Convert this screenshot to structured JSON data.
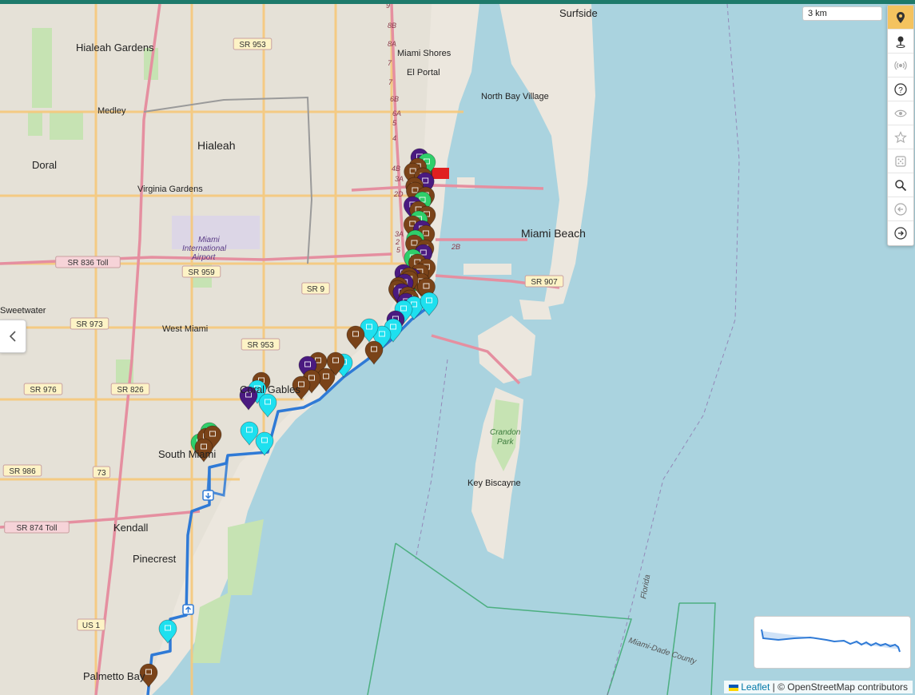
{
  "colors": {
    "topbar": "#1e7a6b",
    "water": "#aad3df",
    "land": "#f2efe9",
    "urban": "#e6e1d8",
    "green": "#c8e6b4",
    "route": "#2f7ad6",
    "marker_brown": "#7a4319",
    "marker_cyan": "#1ee0ef",
    "marker_purple": "#4a1a80",
    "marker_green": "#2fcf6a",
    "flag_red": "#e02020",
    "flag_green": "#2fb84f"
  },
  "scale": {
    "label": "3 km"
  },
  "toolbar": [
    {
      "icon": "map-marker-icon",
      "active": true
    },
    {
      "icon": "pin-icon"
    },
    {
      "icon": "broadcast-icon"
    },
    {
      "icon": "help-icon"
    },
    {
      "icon": "eye-icon"
    },
    {
      "icon": "star-icon"
    },
    {
      "icon": "dice-icon"
    },
    {
      "icon": "search-icon"
    },
    {
      "icon": "back-icon"
    },
    {
      "icon": "forward-icon"
    }
  ],
  "places": [
    "Surfside",
    "Hialeah Gardens",
    "Miami Shores",
    "El Portal",
    "North Bay Village",
    "Medley",
    "Hialeah",
    "Doral",
    "Virginia Gardens",
    "Miami International Airport",
    "Miami Beach",
    "West Miami",
    "Coral Gables",
    "South Miami",
    "Kendall",
    "Pinecrest",
    "Palmetto Bay",
    "Key Biscayne",
    "Crandon Park",
    "Florida",
    "Miami-Dade County",
    "Sweetwater"
  ],
  "road_labels": [
    "SR 953",
    "SR 836 Toll",
    "SR 959",
    "SR 9",
    "SR 907",
    "SR 973",
    "SR 953",
    "SR 976",
    "SR 826",
    "SR 986",
    "73",
    "SR 874 Toll",
    "US 1"
  ],
  "exit_labels": [
    "9",
    "8B",
    "8A",
    "7",
    "7",
    "6B",
    "6A",
    "5",
    "4",
    "4B",
    "3A",
    "2D",
    "3A",
    "2",
    "5",
    "2B"
  ],
  "attribution": {
    "leaflet": "Leaflet",
    "rest": "| © OpenStreetMap contributors"
  }
}
